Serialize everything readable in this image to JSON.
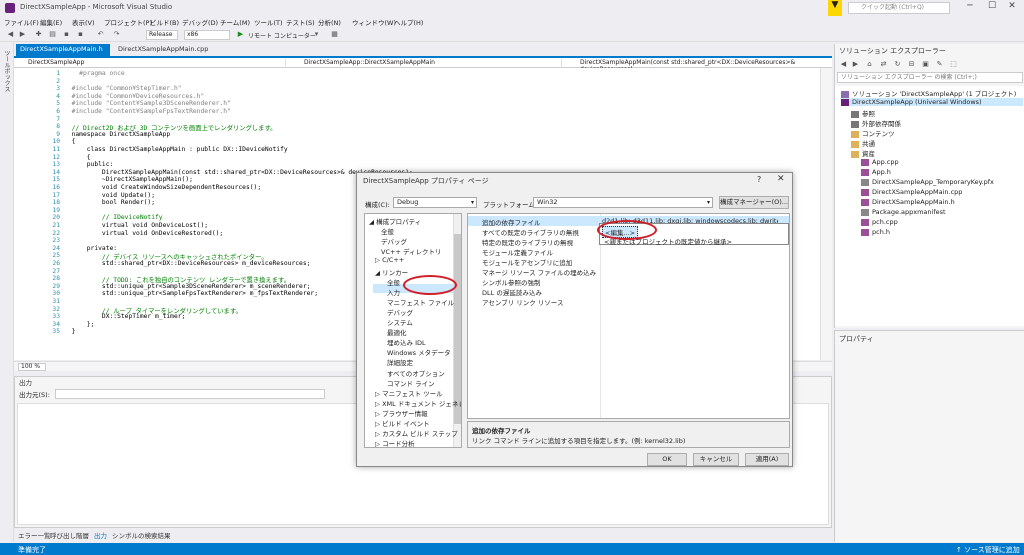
{
  "window": {
    "title": "DirectXSampleApp - Microsoft Visual Studio",
    "quick_launch_placeholder": "クイック起動 (Ctrl+Q)"
  },
  "menu": [
    "ファイル(F)",
    "編集(E)",
    "表示(V)",
    "プロジェクト(P)",
    "ビルド(B)",
    "デバッグ(D)",
    "チーム(M)",
    "ツール(T)",
    "テスト(S)",
    "分析(N)",
    "ウィンドウ(W)",
    "ヘルプ(H)"
  ],
  "toolbar": {
    "configuration": "Release",
    "platform": "x86",
    "debugger": "リモート コンピューター"
  },
  "left_strip": "ツールボックス",
  "editor": {
    "tabs": [
      "DirectXSampleAppMain.h",
      "DirectXSampleAppMain.cpp"
    ],
    "nav": [
      "DirectXSampleApp",
      "DirectXSampleApp::DirectXSampleAppMain",
      "DirectXSampleAppMain(const std::shared_ptr<DX::DeviceResources>& deviceResources)"
    ],
    "zoom": "100 %",
    "lines": [
      {
        "n": "1",
        "t": "    #pragma once"
      },
      {
        "n": "2",
        "t": ""
      },
      {
        "n": "3",
        "t": "  #include \"Common¥StepTimer.h\""
      },
      {
        "n": "4",
        "t": "  #include \"Common¥DeviceResources.h\""
      },
      {
        "n": "5",
        "t": "  #include \"Content¥Sample3DSceneRenderer.h\""
      },
      {
        "n": "6",
        "t": "  #include \"Content¥SampleFpsTextRenderer.h\""
      },
      {
        "n": "7",
        "t": ""
      },
      {
        "n": "8",
        "t": "  // Direct2D および 3D コンテンツを画面上でレンダリングします。"
      },
      {
        "n": "9",
        "t": "  namespace DirectXSampleApp"
      },
      {
        "n": "10",
        "t": "  {"
      },
      {
        "n": "11",
        "t": "      class DirectXSampleAppMain : public DX::IDeviceNotify"
      },
      {
        "n": "12",
        "t": "      {"
      },
      {
        "n": "13",
        "t": "      public:"
      },
      {
        "n": "14",
        "t": "          DirectXSampleAppMain(const std::shared_ptr<DX::DeviceResources>& deviceResources);"
      },
      {
        "n": "15",
        "t": "          ~DirectXSampleAppMain();"
      },
      {
        "n": "16",
        "t": "          void CreateWindowSizeDependentResources();"
      },
      {
        "n": "17",
        "t": "          void Update();"
      },
      {
        "n": "18",
        "t": "          bool Render();"
      },
      {
        "n": "19",
        "t": ""
      },
      {
        "n": "20",
        "t": "          // IDeviceNotify"
      },
      {
        "n": "21",
        "t": "          virtual void OnDeviceLost();"
      },
      {
        "n": "22",
        "t": "          virtual void OnDeviceRestored();"
      },
      {
        "n": "23",
        "t": ""
      },
      {
        "n": "24",
        "t": "      private:"
      },
      {
        "n": "25",
        "t": "          // デバイス リソースへのキャッシュされたポインター。"
      },
      {
        "n": "26",
        "t": "          std::shared_ptr<DX::DeviceResources> m_deviceResources;"
      },
      {
        "n": "27",
        "t": ""
      },
      {
        "n": "28",
        "t": "          // TODO: これを独自のコンテンツ レンダラーで置き換えます。"
      },
      {
        "n": "29",
        "t": "          std::unique_ptr<Sample3DSceneRenderer> m_sceneRenderer;"
      },
      {
        "n": "30",
        "t": "          std::unique_ptr<SampleFpsTextRenderer> m_fpsTextRenderer;"
      },
      {
        "n": "31",
        "t": ""
      },
      {
        "n": "32",
        "t": "          // ループ タイマーをレンダリングしています。"
      },
      {
        "n": "33",
        "t": "          DX::StepTimer m_timer;"
      },
      {
        "n": "34",
        "t": "      };"
      },
      {
        "n": "35",
        "t": "  }"
      }
    ]
  },
  "output": {
    "title": "出力",
    "source_label": "出力元(S):",
    "bottom_tabs": [
      "エラー一覧",
      "呼び出し階層",
      "出力",
      "シンボルの検索結果"
    ]
  },
  "status": {
    "left": "準備完了",
    "right": "↑ ソース管理に追加"
  },
  "solution_explorer": {
    "title": "ソリューション エクスプローラー",
    "search_placeholder": "ソリューション エクスプローラー の検索 (Ctrl+;)",
    "items": [
      "ソリューション 'DirectXSampleApp' (1 プロジェクト)",
      "DirectXSampleApp (Universal Windows)",
      "参照",
      "外部依存関係",
      "コンテンツ",
      "共通",
      "資産",
      "App.cpp",
      "App.h",
      "DirectXSampleApp_TemporaryKey.pfx",
      "DirectXSampleAppMain.cpp",
      "DirectXSampleAppMain.h",
      "Package.appxmanifest",
      "pch.cpp",
      "pch.h"
    ]
  },
  "properties_panel": {
    "title": "プロパティ"
  },
  "dialog": {
    "title": "DirectXSampleApp プロパティ ページ",
    "help": "?",
    "close": "✕",
    "config_label": "構成(C):",
    "config_value": "Debug",
    "platform_label": "プラットフォーム(P):",
    "platform_value": "Win32",
    "config_manager": "構成マネージャー(O)...",
    "tree": [
      {
        "t": "◢ 構成プロパティ",
        "lvl": 0
      },
      {
        "t": "全般",
        "lvl": 2
      },
      {
        "t": "デバッグ",
        "lvl": 2
      },
      {
        "t": "VC++ ディレクトリ",
        "lvl": 2
      },
      {
        "t": "▷ C/C++",
        "lvl": 1
      },
      {
        "t": "◢ リンカー",
        "lvl": 1
      },
      {
        "t": "全般",
        "lvl": 3
      },
      {
        "t": "入力",
        "lvl": 3
      },
      {
        "t": "マニフェスト ファイル",
        "lvl": 3
      },
      {
        "t": "デバッグ",
        "lvl": 3
      },
      {
        "t": "システム",
        "lvl": 3
      },
      {
        "t": "最適化",
        "lvl": 3
      },
      {
        "t": "埋め込み IDL",
        "lvl": 3
      },
      {
        "t": "Windows メタデータ",
        "lvl": 3
      },
      {
        "t": "詳細設定",
        "lvl": 3
      },
      {
        "t": "すべてのオプション",
        "lvl": 3
      },
      {
        "t": "コマンド ライン",
        "lvl": 3
      },
      {
        "t": "▷ マニフェスト ツール",
        "lvl": 1
      },
      {
        "t": "▷ XML ドキュメント ジェネレー",
        "lvl": 1
      },
      {
        "t": "▷ ブラウザー情報",
        "lvl": 1
      },
      {
        "t": "▷ ビルド イベント",
        "lvl": 1
      },
      {
        "t": "▷ カスタム ビルド ステップ",
        "lvl": 1
      },
      {
        "t": "▷ コード分析",
        "lvl": 1
      }
    ],
    "grid": [
      {
        "k": "追加の依存ファイル",
        "v": "d2d1.lib; d3d11.lib; dxgi.lib; windowscodecs.lib; dwrite.lib; %(AdditionalDependencies)"
      },
      {
        "k": "すべての既定のライブラリの無視",
        "v": ""
      },
      {
        "k": "特定の既定のライブラリの無視",
        "v": ""
      },
      {
        "k": "モジュール定義ファイル",
        "v": ""
      },
      {
        "k": "モジュールをアセンブリに追加",
        "v": ""
      },
      {
        "k": "マネージ リソース ファイルの埋め込み",
        "v": ""
      },
      {
        "k": "シンボル参照の強制",
        "v": ""
      },
      {
        "k": "DLL の遅延読み込み",
        "v": ""
      },
      {
        "k": "アセンブリ リンク リソース",
        "v": ""
      }
    ],
    "dropdown": [
      "<編集...>",
      "<親またはプロジェクトの既定値から継承>"
    ],
    "desc_title": "追加の依存ファイル",
    "desc_text": "リンク コマンド ラインに追加する項目を指定します。(例: kernel32.lib)",
    "ok": "OK",
    "cancel": "キャンセル",
    "apply": "適用(A)"
  },
  "colors": {
    "accent": "#007acc",
    "highlight": "#d0202a"
  }
}
